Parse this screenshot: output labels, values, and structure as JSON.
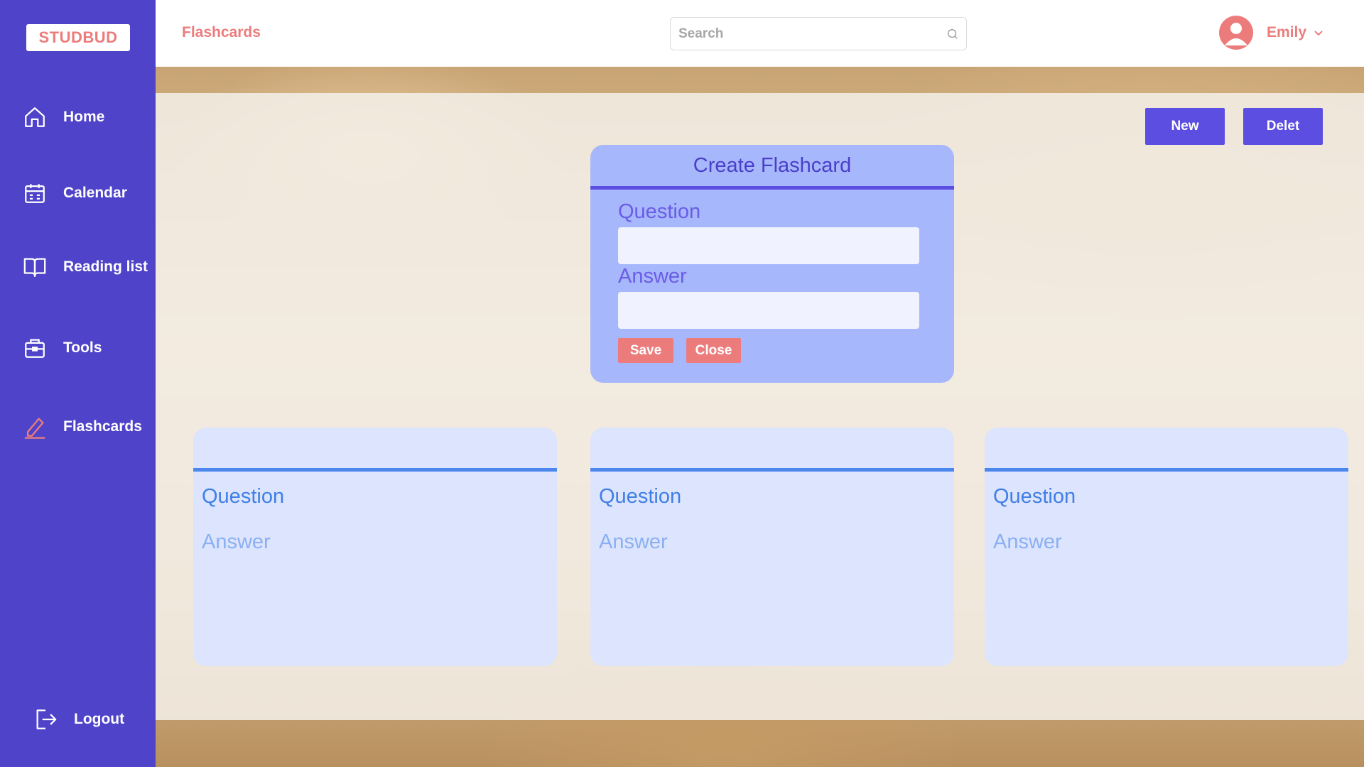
{
  "app": {
    "logo": "STUDBUD"
  },
  "sidebar": {
    "items": [
      {
        "label": "Home",
        "icon": "home-icon"
      },
      {
        "label": "Calendar",
        "icon": "calendar-icon"
      },
      {
        "label": "Reading list",
        "icon": "book-icon"
      },
      {
        "label": "Tools",
        "icon": "toolbox-icon"
      },
      {
        "label": "Flashcards",
        "icon": "pencil-icon"
      }
    ],
    "logout_label": "Logout"
  },
  "header": {
    "title": "Flashcards",
    "search_placeholder": "Search",
    "user_name": "Emily"
  },
  "actions": {
    "new_label": "New",
    "delete_label": "Delet"
  },
  "modal": {
    "title": "Create Flashcard",
    "question_label": "Question",
    "answer_label": "Answer",
    "question_value": "",
    "answer_value": "",
    "save_label": "Save",
    "close_label": "Close"
  },
  "cards": [
    {
      "question": "Question",
      "answer": "Answer"
    },
    {
      "question": "Question",
      "answer": "Answer"
    },
    {
      "question": "Question",
      "answer": "Answer"
    }
  ],
  "colors": {
    "sidebar": "#4f44c9",
    "accent": "#5b4ee0",
    "brand_pink": "#ec7c7c",
    "modal_bg": "#a7b7fb",
    "card_bg": "#dde4fd",
    "card_rule": "#4a86ec"
  }
}
